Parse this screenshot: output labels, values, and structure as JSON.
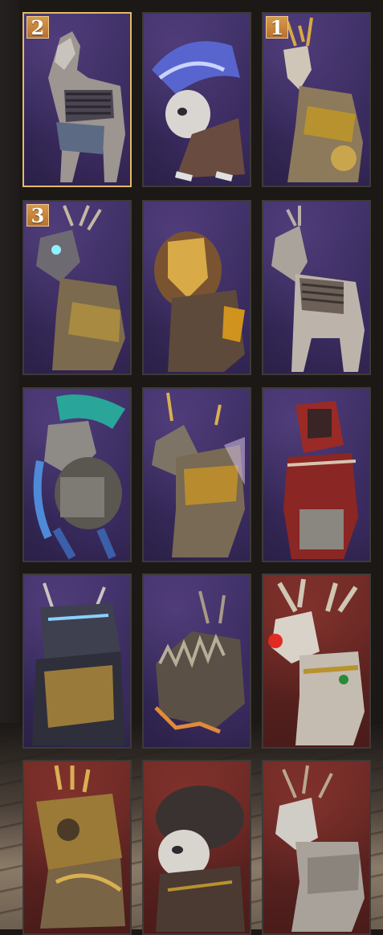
{
  "colors": {
    "selected_border": "#e4b969",
    "tile_border": "#3e3a37",
    "rank_badge": "#c7823a",
    "purple_bg": "#352a5a",
    "red_bg": "#5e2421"
  },
  "mounts": [
    {
      "name": "armored-horse-mount",
      "bg": "purple",
      "rank": "2",
      "selected": true
    },
    {
      "name": "frost-panda-mount",
      "bg": "purple",
      "rank": "",
      "selected": false
    },
    {
      "name": "golden-stag-mount",
      "bg": "purple",
      "rank": "1",
      "selected": false
    },
    {
      "name": "glowing-eye-stag-mount",
      "bg": "purple",
      "rank": "3",
      "selected": false
    },
    {
      "name": "golden-lion-mount",
      "bg": "purple",
      "rank": "",
      "selected": false
    },
    {
      "name": "silver-horse-mount",
      "bg": "purple",
      "rank": "",
      "selected": false
    },
    {
      "name": "feathered-elephant-mount",
      "bg": "purple",
      "rank": "",
      "selected": false
    },
    {
      "name": "golden-wolf-mount",
      "bg": "purple",
      "rank": "",
      "selected": false
    },
    {
      "name": "red-armored-mount",
      "bg": "purple",
      "rank": "",
      "selected": false
    },
    {
      "name": "dark-armored-beast-mount",
      "bg": "purple",
      "rank": "",
      "selected": false
    },
    {
      "name": "spiked-boar-mount",
      "bg": "purple",
      "rank": "",
      "selected": false
    },
    {
      "name": "festive-reindeer-mount",
      "bg": "red",
      "rank": "",
      "selected": false
    },
    {
      "name": "golden-spiked-beast-mount",
      "bg": "red",
      "rank": "",
      "selected": false
    },
    {
      "name": "dark-panda-mount",
      "bg": "red",
      "rank": "",
      "selected": false
    },
    {
      "name": "silver-stag-mount",
      "bg": "red",
      "rank": "",
      "selected": false
    }
  ]
}
